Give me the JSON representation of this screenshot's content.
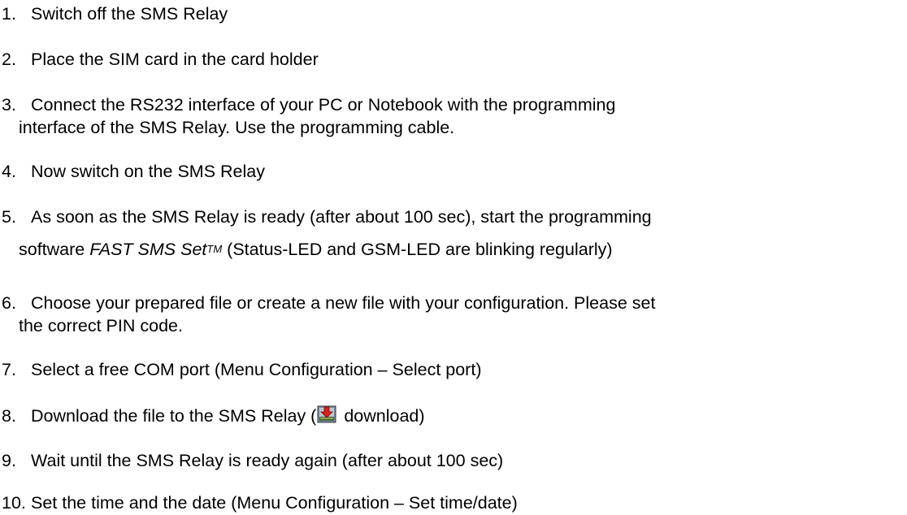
{
  "steps": [
    {
      "num": "1.",
      "text": "Switch off the SMS Relay"
    },
    {
      "num": "2.",
      "text": "Place the SIM card in the card holder"
    },
    {
      "num": "3.",
      "text": "Connect the RS232 interface of your PC or Notebook with the programming",
      "text2": "interface of the SMS Relay. Use the programming cable."
    },
    {
      "num": "4.",
      "text": "Now switch on the SMS Relay"
    },
    {
      "num": "5.",
      "text": "As soon as the SMS Relay is ready (after about 100 sec), start the programming",
      "text2_pre": "software ",
      "software_name": "FAST SMS Set",
      "trademark": "TM",
      "text2_post": " (Status-LED and GSM-LED are blinking regularly)"
    },
    {
      "num": "6.",
      "text": "Choose your prepared file or create a new file with your configuration. Please set",
      "text2": "the correct PIN code."
    },
    {
      "num": "7.",
      "text": "Select a free COM port (Menu Configuration – Select port)"
    },
    {
      "num": "8.",
      "text": "Download the file to the SMS Relay (",
      "icon": "download-icon",
      "text_post": " download)"
    },
    {
      "num": "9.",
      "text": "Wait until the SMS Relay is ready again (after about 100 sec)"
    },
    {
      "num": "10.",
      "text": "Set the time and the date (Menu Configuration – Set time/date)"
    }
  ]
}
